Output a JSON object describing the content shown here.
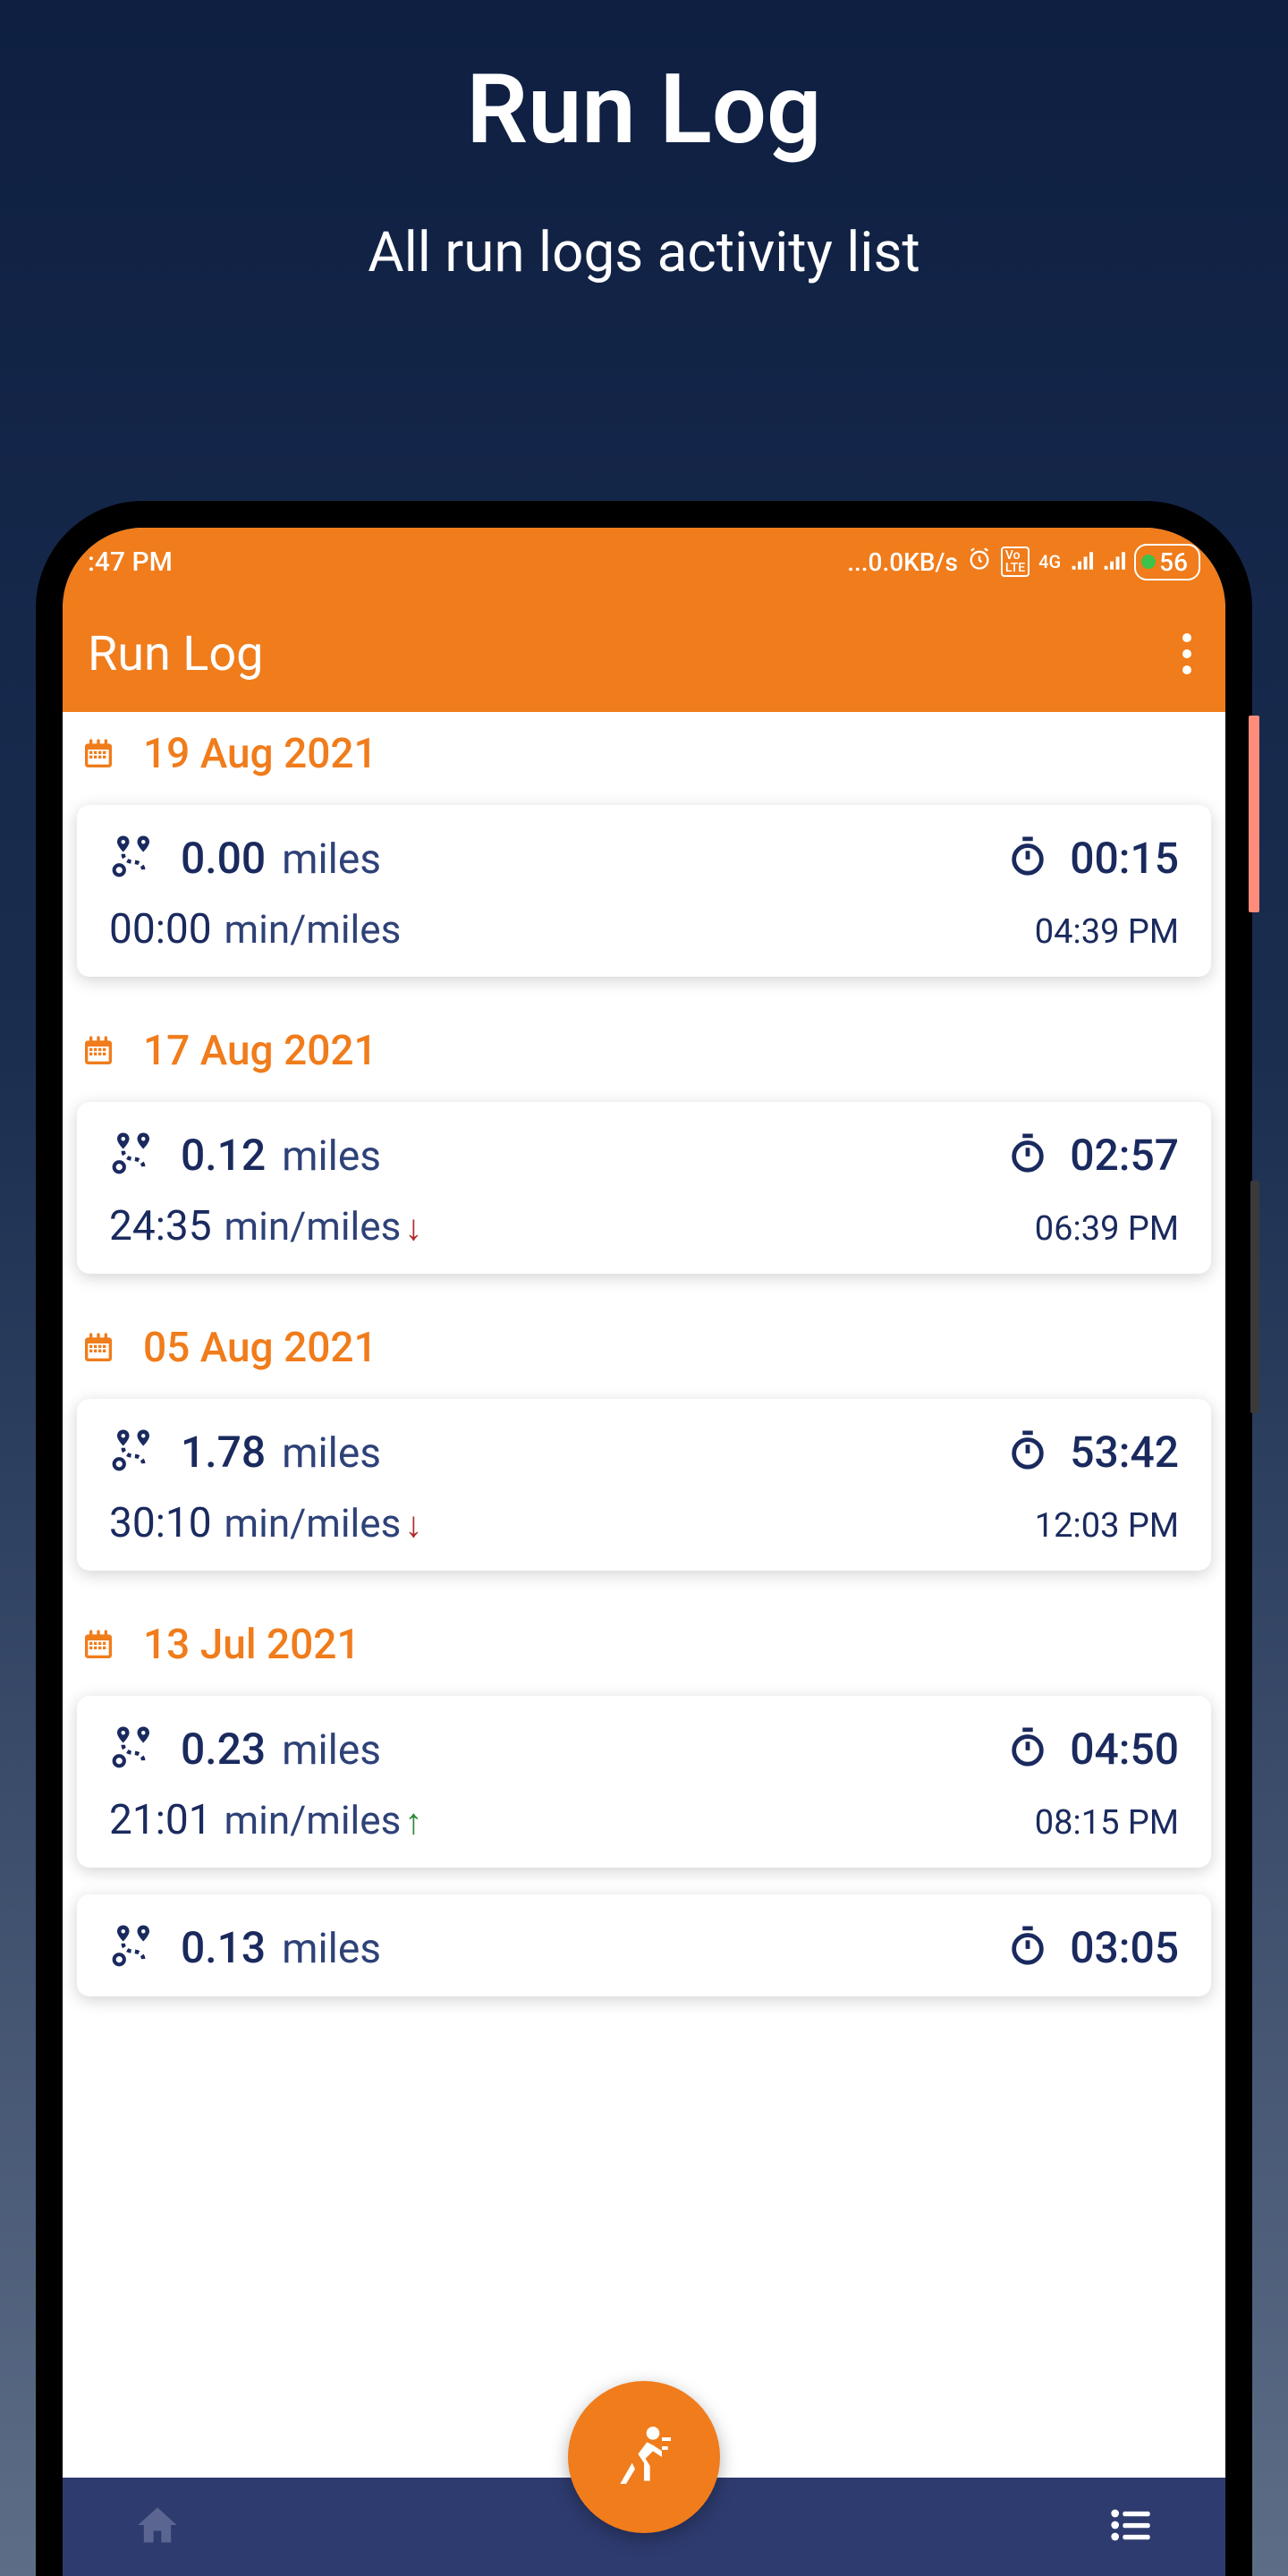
{
  "page": {
    "title": "Run Log",
    "subtitle": "All run logs activity list"
  },
  "status_bar": {
    "time": ":47 PM",
    "data_rate": "...0.0KB/s",
    "battery": "56"
  },
  "app_bar": {
    "title": "Run Log"
  },
  "logs": [
    {
      "date": "19 Aug 2021",
      "distance": "0.00",
      "unit": "miles",
      "duration": "00:15",
      "pace": "00:00",
      "pace_unit": "min/miles",
      "trend": "",
      "time": "04:39 PM"
    },
    {
      "date": "17 Aug 2021",
      "distance": "0.12",
      "unit": "miles",
      "duration": "02:57",
      "pace": "24:35",
      "pace_unit": "min/miles",
      "trend": "down",
      "time": "06:39 PM"
    },
    {
      "date": "05 Aug 2021",
      "distance": "1.78",
      "unit": "miles",
      "duration": "53:42",
      "pace": "30:10",
      "pace_unit": "min/miles",
      "trend": "down",
      "time": "12:03 PM"
    },
    {
      "date": "13 Jul 2021",
      "distance": "0.23",
      "unit": "miles",
      "duration": "04:50",
      "pace": "21:01",
      "pace_unit": "min/miles",
      "trend": "up",
      "time": "08:15 PM"
    },
    {
      "date": "",
      "distance": "0.13",
      "unit": "miles",
      "duration": "03:05",
      "pace": "",
      "pace_unit": "",
      "trend": "",
      "time": ""
    }
  ]
}
